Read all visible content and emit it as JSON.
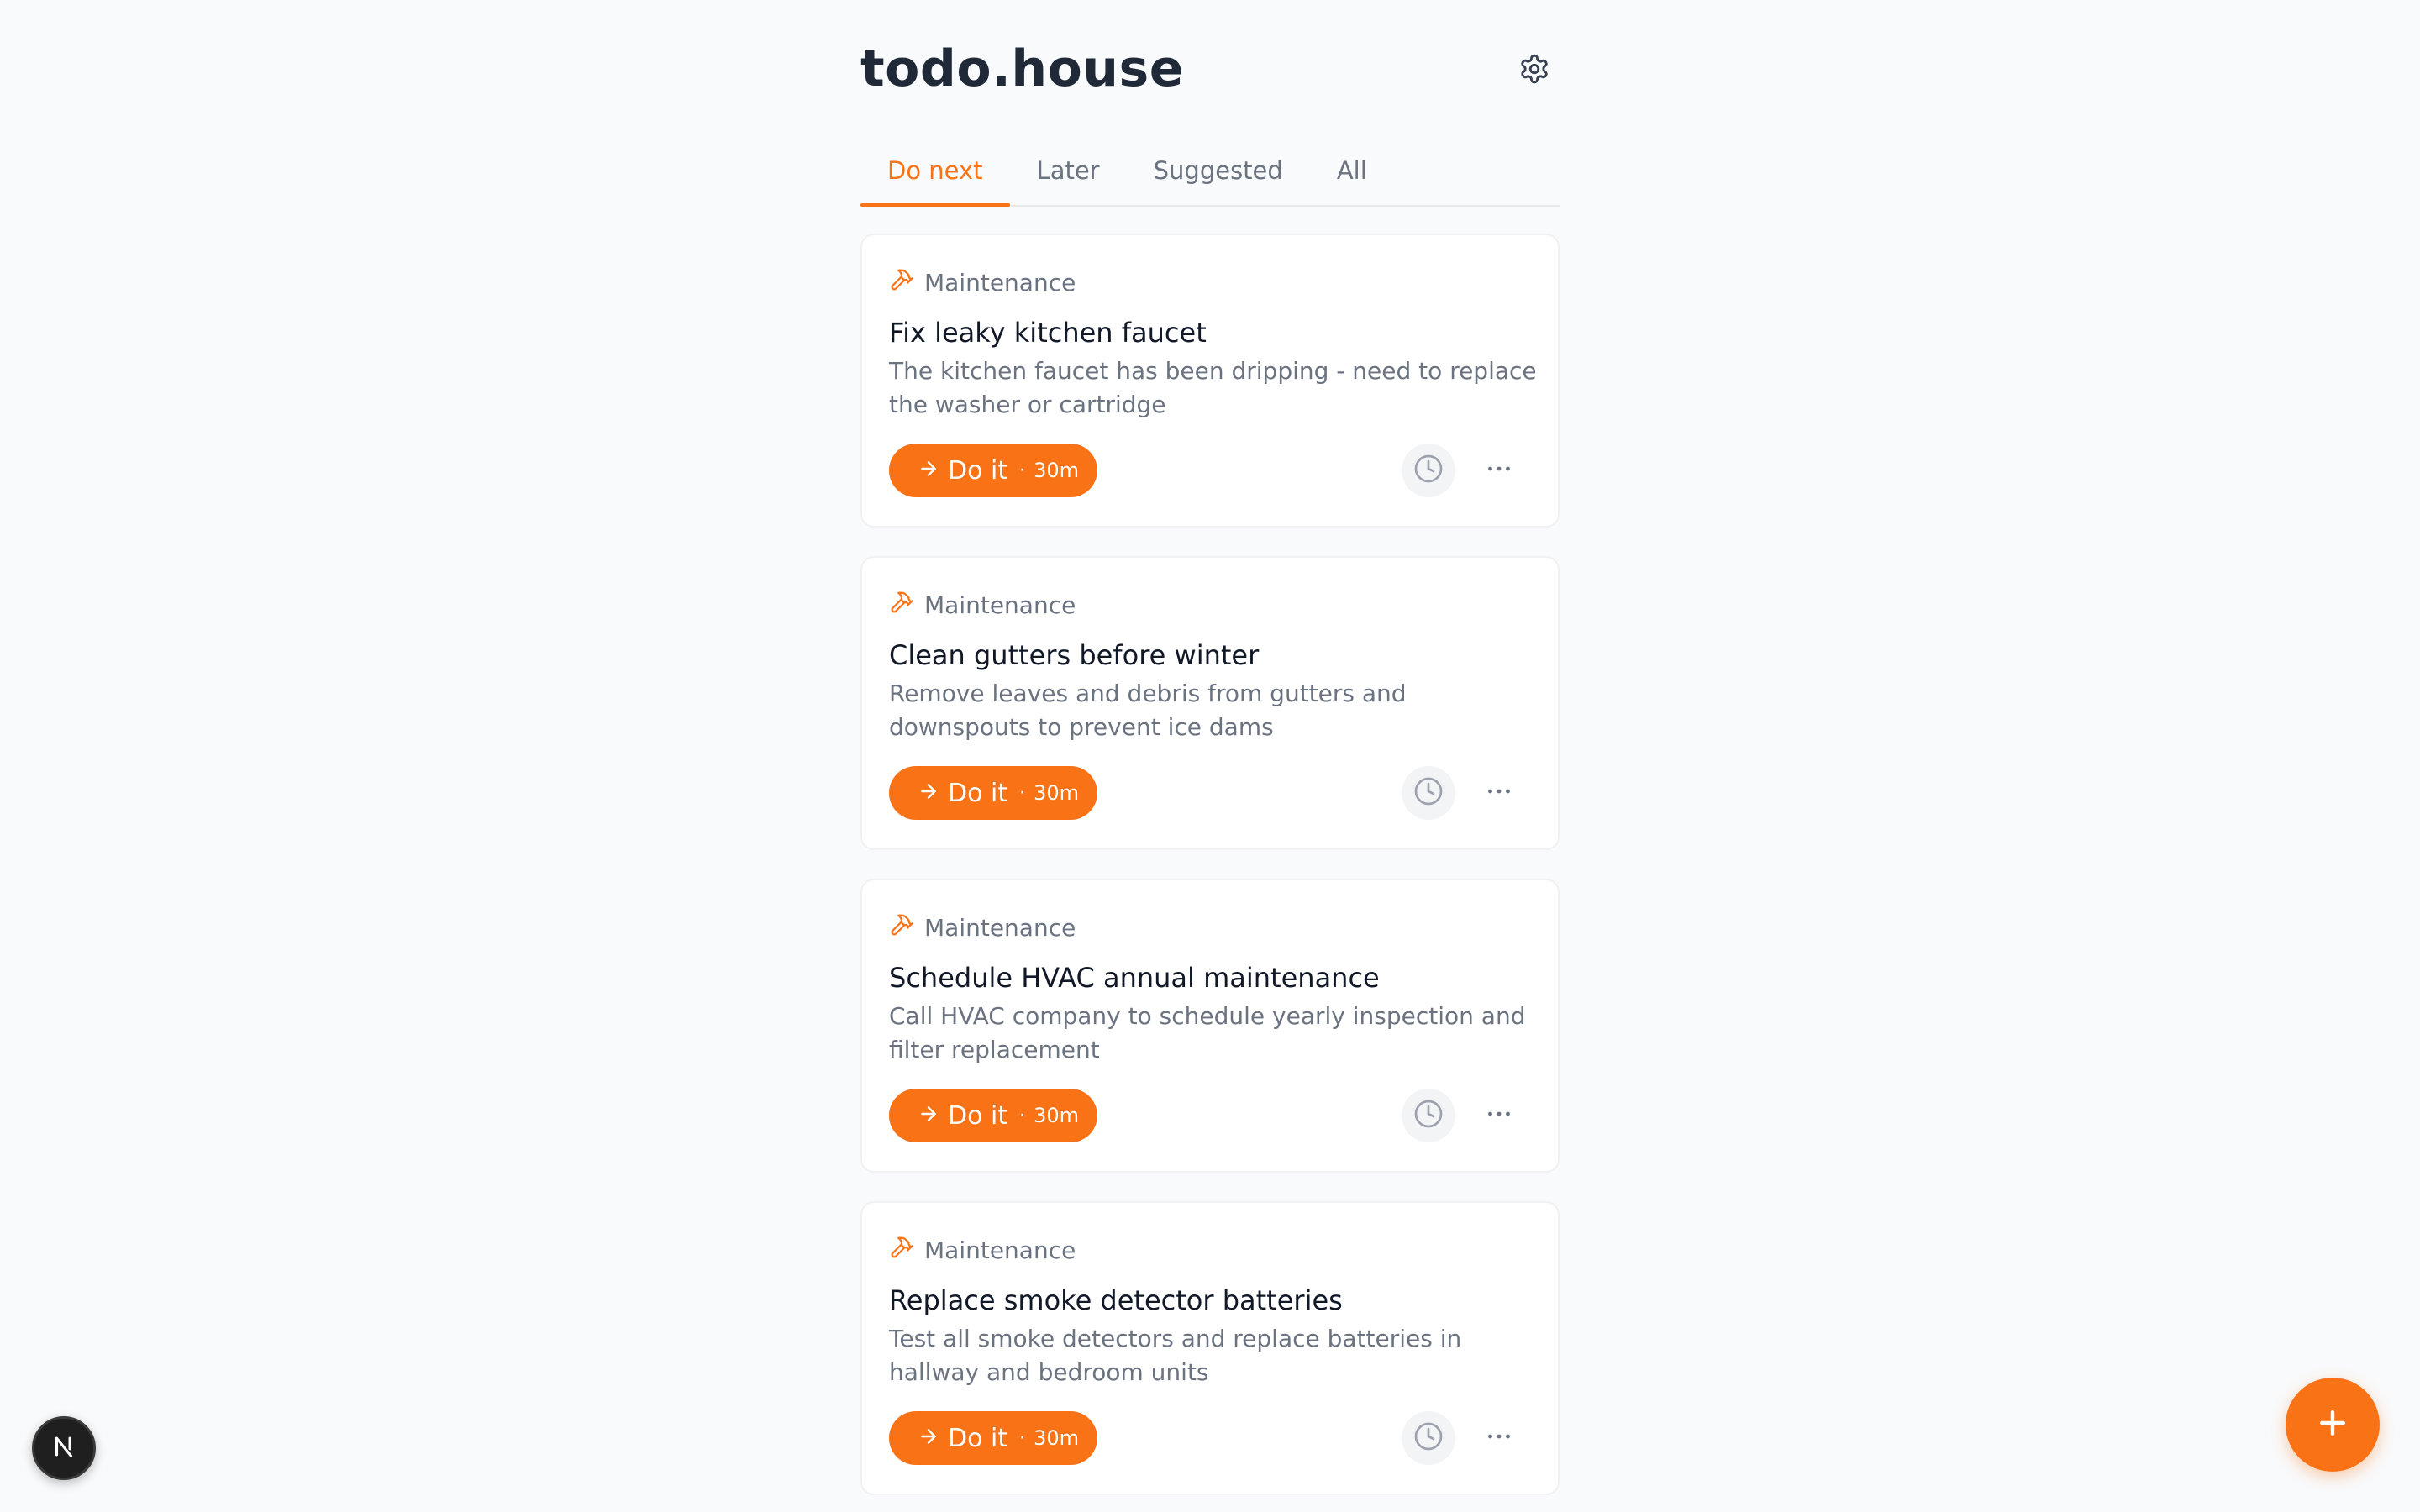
{
  "app": {
    "title": "todo.house"
  },
  "tabs": [
    {
      "label": "Do next",
      "active": true
    },
    {
      "label": "Later",
      "active": false
    },
    {
      "label": "Suggested",
      "active": false
    },
    {
      "label": "All",
      "active": false
    }
  ],
  "tasks": [
    {
      "category": "Maintenance",
      "category_icon": "hammer-icon",
      "title": "Fix leaky kitchen faucet",
      "description": "The kitchen faucet has been dripping - need to replace the washer or cartridge",
      "action_label": "Do it",
      "separator": "·",
      "duration": "30m"
    },
    {
      "category": "Maintenance",
      "category_icon": "hammer-icon",
      "title": "Clean gutters before winter",
      "description": "Remove leaves and debris from gutters and downspouts to prevent ice dams",
      "action_label": "Do it",
      "separator": "·",
      "duration": "30m"
    },
    {
      "category": "Maintenance",
      "category_icon": "hammer-icon",
      "title": "Schedule HVAC annual maintenance",
      "description": "Call HVAC company to schedule yearly inspection and filter replacement",
      "action_label": "Do it",
      "separator": "·",
      "duration": "30m"
    },
    {
      "category": "Maintenance",
      "category_icon": "hammer-icon",
      "title": "Replace smoke detector batteries",
      "description": "Test all smoke detectors and replace batteries in hallway and bedroom units",
      "action_label": "Do it",
      "separator": "·",
      "duration": "30m"
    }
  ],
  "colors": {
    "accent": "#f97316",
    "background": "#f9fafb",
    "text_primary": "#111827",
    "text_secondary": "#6b7280"
  },
  "icons": {
    "settings": "gear-icon",
    "add": "plus-icon",
    "snooze": "clock-icon",
    "more": "more-horizontal-icon",
    "action": "arrow-right-icon",
    "dev_badge": "nextjs-logo-icon"
  },
  "dev_badge": {
    "letter": "N"
  }
}
